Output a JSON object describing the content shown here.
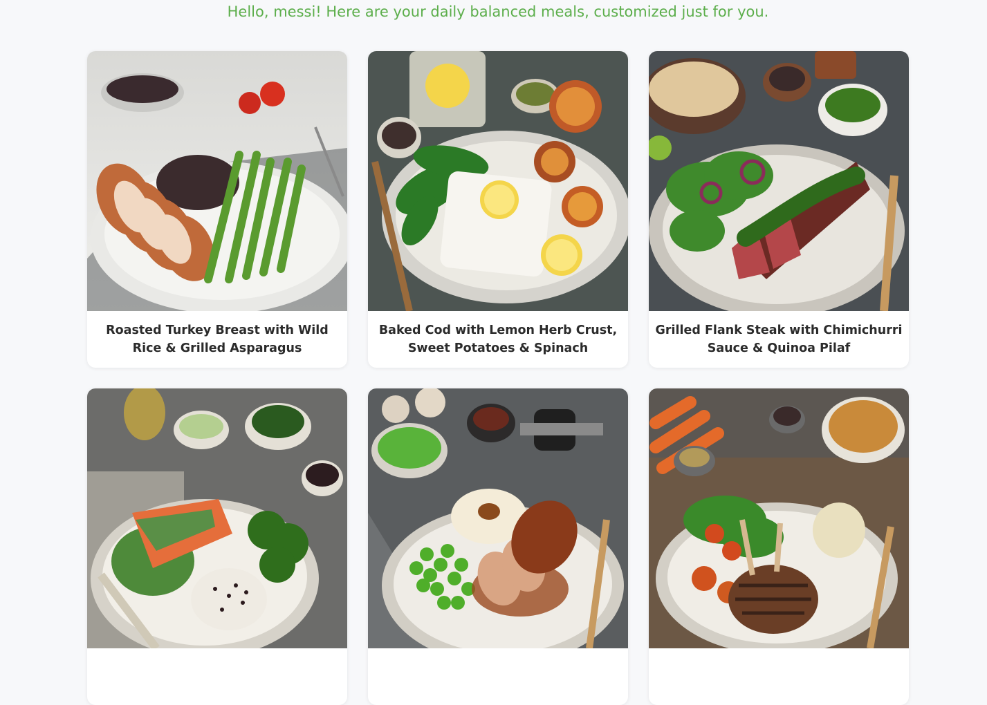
{
  "greeting": "Hello, messi! Here are your daily balanced meals, customized just for you.",
  "meals": [
    {
      "title": "Roasted Turkey Breast with Wild Rice & Grilled Asparagus",
      "image": "turkey-asparagus-photo"
    },
    {
      "title": "Baked Cod with Lemon Herb Crust, Sweet Potatoes & Spinach",
      "image": "cod-lemon-photo"
    },
    {
      "title": "Grilled Flank Steak with Chimichurri Sauce & Quinoa Pilaf",
      "image": "flank-steak-photo"
    },
    {
      "title": "",
      "image": "salmon-wild-rice-photo"
    },
    {
      "title": "",
      "image": "pork-peas-photo"
    },
    {
      "title": "",
      "image": "lamb-chops-photo"
    }
  ]
}
